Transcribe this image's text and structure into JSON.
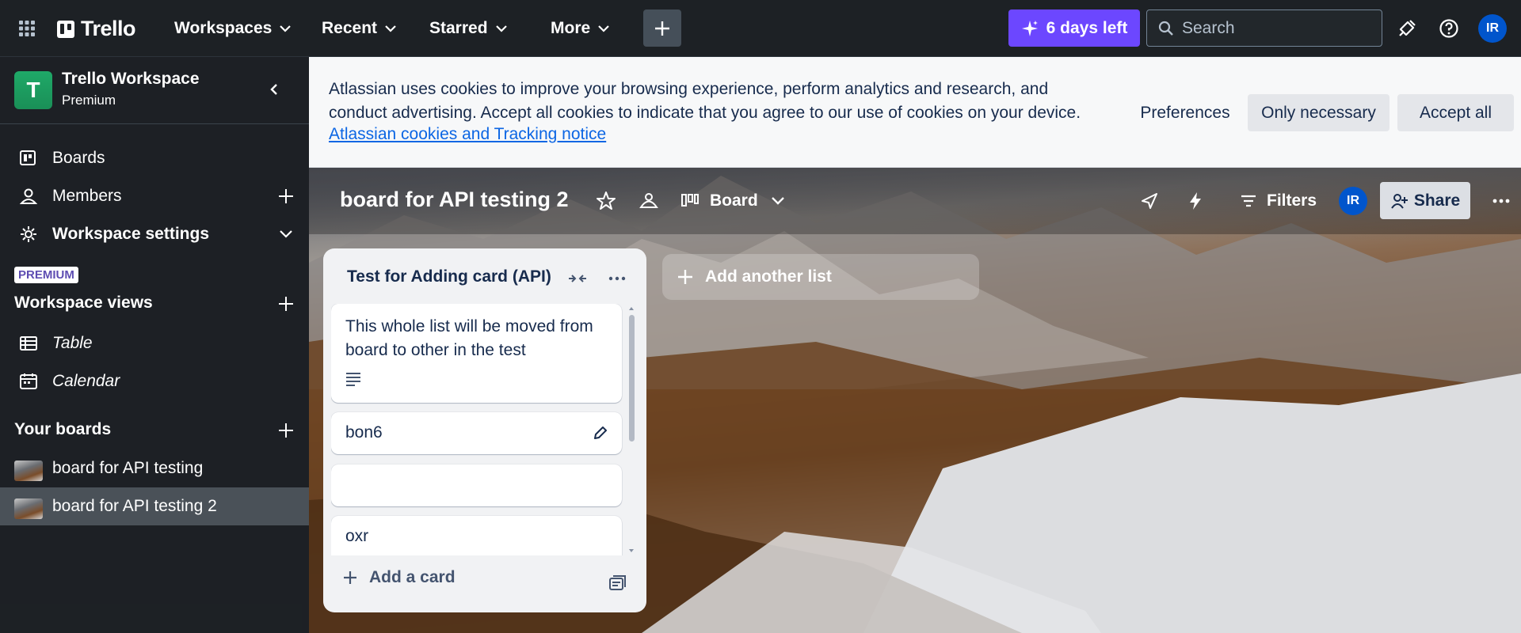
{
  "nav": {
    "logo_text": "Trello",
    "menus": [
      {
        "label": "Workspaces"
      },
      {
        "label": "Recent"
      },
      {
        "label": "Starred"
      },
      {
        "label": "More"
      }
    ],
    "trial_label": "6 days left",
    "search_placeholder": "Search",
    "avatar_initials": "IR"
  },
  "sidebar": {
    "workspace_initial": "T",
    "workspace_name": "Trello Workspace",
    "workspace_plan": "Premium",
    "items": [
      {
        "label": "Boards"
      },
      {
        "label": "Members"
      },
      {
        "label": "Workspace settings"
      }
    ],
    "premium_badge": "PREMIUM",
    "views_title": "Workspace views",
    "views": [
      {
        "label": "Table"
      },
      {
        "label": "Calendar"
      }
    ],
    "boards_title": "Your boards",
    "boards": [
      {
        "label": "board for API testing"
      },
      {
        "label": "board for API testing 2"
      }
    ]
  },
  "cookie_banner": {
    "text": "Atlassian uses cookies to improve your browsing experience, perform analytics and research, and conduct advertising. Accept all cookies to indicate that you agree to our use of cookies on your device.",
    "link": "Atlassian cookies and Tracking notice",
    "preferences": "Preferences",
    "only_necessary": "Only necessary",
    "accept_all": "Accept all"
  },
  "board": {
    "title": "board for API testing 2",
    "view_label": "Board",
    "filters_label": "Filters",
    "member_initials": "IR",
    "share_label": "Share"
  },
  "list": {
    "title": "Test for Adding card (API)",
    "cards": [
      {
        "text": "This whole list will be moved from board to other in the test"
      },
      {
        "text": "bon6"
      },
      {
        "text": ""
      },
      {
        "text": "oxr"
      }
    ],
    "add_card_label": "Add a card"
  },
  "add_list_label": "Add another list",
  "colors": {
    "nav_bg": "#1d2125",
    "trial_purple": "#6c47ff",
    "workspace_green": "#1fa968",
    "link_blue": "#0c66e4",
    "avatar_blue": "#0055cc"
  }
}
